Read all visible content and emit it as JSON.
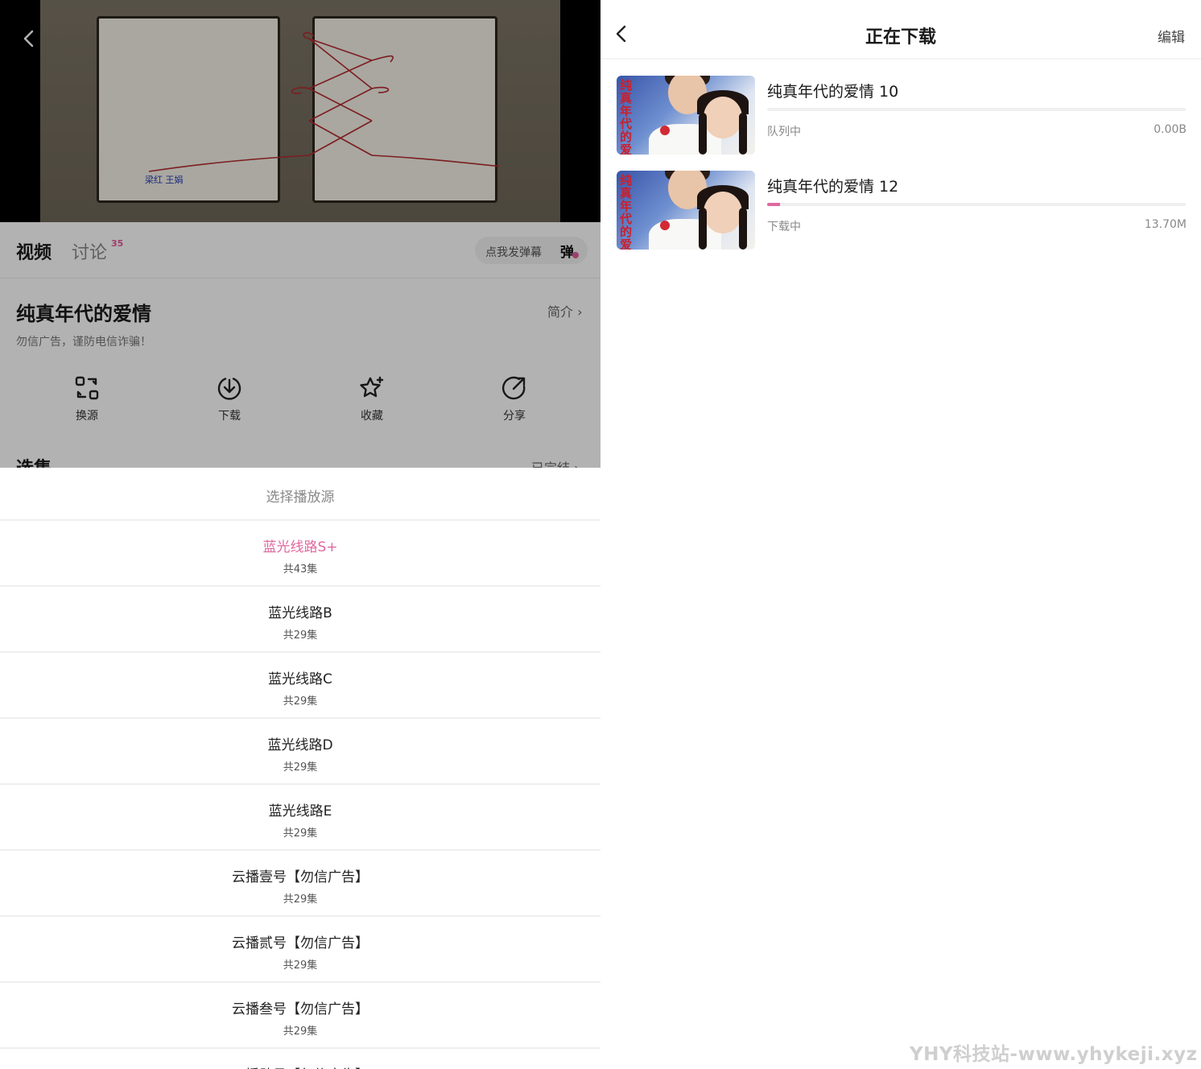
{
  "left": {
    "tabs": {
      "video": "视频",
      "discuss": "讨论",
      "discuss_count": "35"
    },
    "danmu": {
      "placeholder": "点我发弹幕",
      "icon_text": "弹"
    },
    "video_caption": "梁红  王娟",
    "show": {
      "title": "纯真年代的爱情",
      "intro_label": "简介 ›",
      "notice": "勿信广告，谨防电信诈骗！"
    },
    "actions": [
      {
        "label": "换源",
        "icon": "switch-source-icon"
      },
      {
        "label": "下载",
        "icon": "download-icon"
      },
      {
        "label": "收藏",
        "icon": "favorite-star-icon"
      },
      {
        "label": "分享",
        "icon": "share-icon"
      }
    ],
    "episodes": {
      "label": "选集",
      "status": "已完结 ›"
    },
    "sheet": {
      "title": "选择播放源",
      "sources": [
        {
          "name": "蓝光线路S+",
          "count": "共43集",
          "active": true
        },
        {
          "name": "蓝光线路B",
          "count": "共29集"
        },
        {
          "name": "蓝光线路C",
          "count": "共29集"
        },
        {
          "name": "蓝光线路D",
          "count": "共29集"
        },
        {
          "name": "蓝光线路E",
          "count": "共29集"
        },
        {
          "name": "云播壹号【勿信广告】",
          "count": "共29集"
        },
        {
          "name": "云播贰号【勿信广告】",
          "count": "共29集"
        },
        {
          "name": "云播叁号【勿信广告】",
          "count": "共29集"
        },
        {
          "name": "云播肆号【勿信广告】",
          "count": ""
        }
      ]
    }
  },
  "right": {
    "header": {
      "title": "正在下载",
      "edit": "编辑"
    },
    "poster_text": "纯真年代的爱情",
    "downloads": [
      {
        "name": "纯真年代的爱情 10",
        "status": "队列中",
        "size": "0.00B",
        "progress": 0
      },
      {
        "name": "纯真年代的爱情 12",
        "status": "下载中",
        "size": "13.70M",
        "progress": 0.03
      }
    ]
  },
  "watermark": "YHY科技站-www.yhykeji.xyz",
  "colors": {
    "accent": "#e0689f",
    "overlay": "rgba(0,0,0,0.30)",
    "divider": "#efefef"
  }
}
